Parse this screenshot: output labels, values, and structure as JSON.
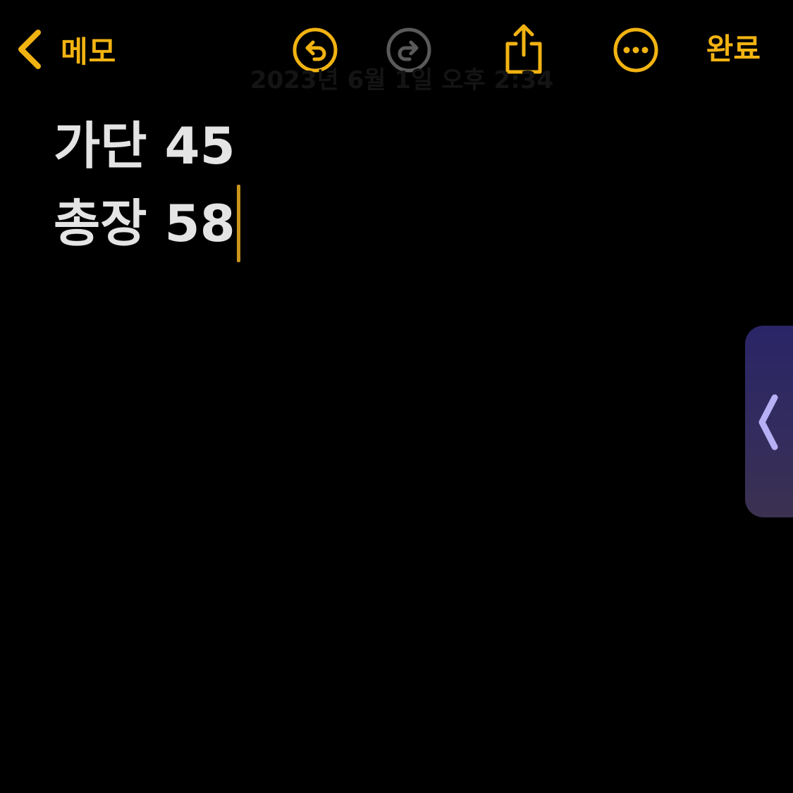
{
  "toolbar": {
    "back_label": "메모",
    "done_label": "완료",
    "accent_color": "#f2b312",
    "disabled_color": "#5a5a5a",
    "icons": [
      "chevron-left-icon",
      "undo-icon",
      "redo-icon",
      "share-icon",
      "more-icon"
    ]
  },
  "note": {
    "faded_header": "2023년 6월 1일 오후 2:34",
    "lines": [
      {
        "text": "가단 45"
      },
      {
        "text": "총장 58"
      }
    ]
  },
  "side_panel": {
    "icon": "chevron-left-icon",
    "gradient_top": "#2a2566",
    "gradient_bottom": "#3b3150"
  }
}
